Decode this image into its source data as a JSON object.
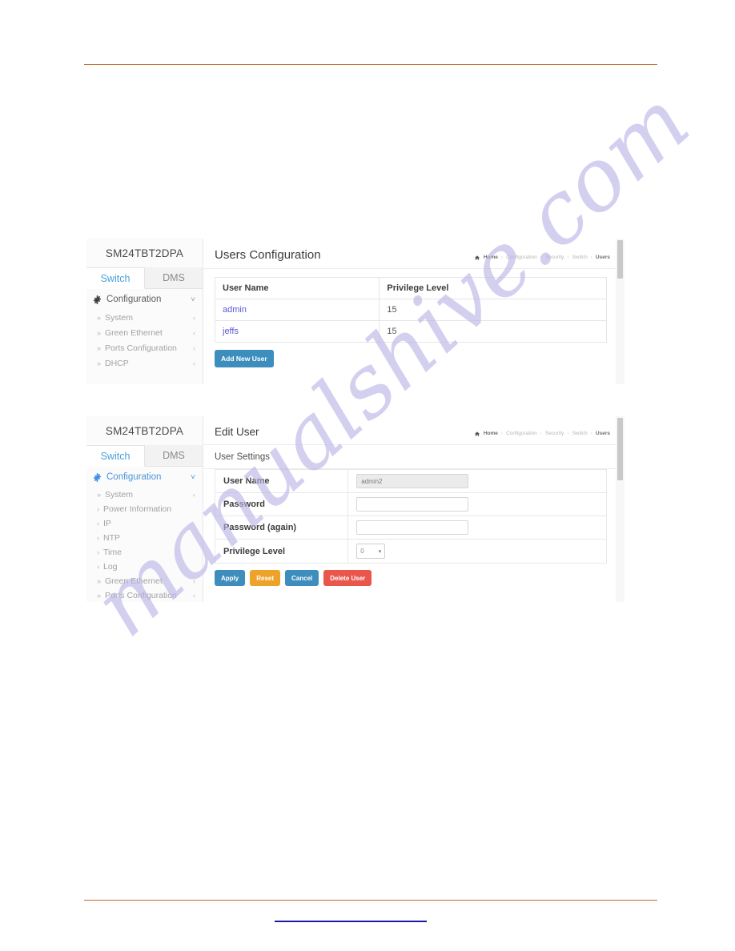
{
  "document": {
    "footer_link_text": "",
    "watermark_text": "manualshive.com",
    "rule_color": "#c4692f",
    "link_underline_color": "#1a1aa8"
  },
  "colors": {
    "accent_blue": "#3d8dbd",
    "link_blue": "#5a5ad6",
    "tab_active": "#48a0dd",
    "btn_apply": "#3d8dbd",
    "btn_reset": "#eda32a",
    "btn_cancel": "#3d8dbd",
    "btn_delete": "#e8564c",
    "btn_add": "#3d8dbd"
  },
  "screenshots": [
    {
      "id": "users-configuration",
      "sidebar": {
        "brand": "SM24TBT2DPA",
        "tabs": [
          {
            "label": "Switch",
            "active": true
          },
          {
            "label": "DMS",
            "active": false
          }
        ],
        "root_item": {
          "label": "Configuration",
          "icon": "gear-icon",
          "caret": "chevron-down-icon"
        },
        "items": [
          {
            "label": "System",
            "chevron": "‹"
          },
          {
            "label": "Green Ethernet",
            "chevron": "‹"
          },
          {
            "label": "Ports Configuration",
            "chevron": "‹"
          },
          {
            "label": "DHCP",
            "chevron": "‹"
          }
        ]
      },
      "header": {
        "title": "Users Configuration",
        "breadcrumb": [
          "Home",
          "Configuration",
          "Security",
          "Switch",
          "Users"
        ]
      },
      "table": {
        "columns": [
          "User Name",
          "Privilege Level"
        ],
        "rows": [
          {
            "user_name": "admin",
            "privilege_level": "15"
          },
          {
            "user_name": "jeffs",
            "privilege_level": "15"
          }
        ]
      },
      "add_button_label": "Add New User"
    },
    {
      "id": "edit-user",
      "sidebar": {
        "brand": "SM24TBT2DPA",
        "tabs": [
          {
            "label": "Switch",
            "active": true
          },
          {
            "label": "DMS",
            "active": false
          }
        ],
        "root_item": {
          "label": "Configuration",
          "icon": "gear-icon",
          "caret": "chevron-down-icon"
        },
        "items": [
          {
            "label": "System",
            "chevron": "‹"
          },
          {
            "label": "Power Information",
            "chevron": ""
          },
          {
            "label": "IP",
            "chevron": ""
          },
          {
            "label": "NTP",
            "chevron": ""
          },
          {
            "label": "Time",
            "chevron": ""
          },
          {
            "label": "Log",
            "chevron": ""
          },
          {
            "label": "Green Ethernet",
            "chevron": "‹"
          },
          {
            "label": "Ports Configuration",
            "chevron": "‹"
          }
        ]
      },
      "header": {
        "title": "Edit User",
        "breadcrumb": [
          "Home",
          "Configuration",
          "Security",
          "Switch",
          "Users"
        ]
      },
      "section_label": "User Settings",
      "form": {
        "fields": [
          {
            "label": "User Name",
            "type": "text",
            "value": "admin2",
            "placeholder": "",
            "disabled": true
          },
          {
            "label": "Password",
            "type": "text",
            "value": "",
            "placeholder": "",
            "disabled": false
          },
          {
            "label": "Password (again)",
            "type": "text",
            "value": "",
            "placeholder": "",
            "disabled": false
          },
          {
            "label": "Privilege Level",
            "type": "select",
            "value": "0",
            "placeholder": "",
            "disabled": false
          }
        ]
      },
      "buttons": [
        {
          "label": "Apply",
          "color": "#3d8dbd"
        },
        {
          "label": "Reset",
          "color": "#eda32a"
        },
        {
          "label": "Cancel",
          "color": "#3d8dbd"
        },
        {
          "label": "Delete User",
          "color": "#e8564c"
        }
      ]
    }
  ]
}
